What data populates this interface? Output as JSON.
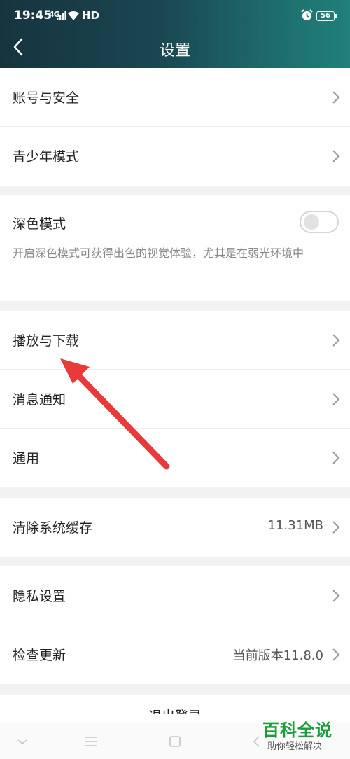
{
  "status_bar": {
    "time": "19:45",
    "network": "4G",
    "hd": "HD",
    "battery": "56"
  },
  "header": {
    "title": "设置"
  },
  "groups": {
    "account": [
      {
        "label": "账号与安全"
      },
      {
        "label": "青少年模式"
      }
    ],
    "dark_mode": {
      "title": "深色模式",
      "description": "开启深色模式可获得出色的视觉体验，尤其是在弱光环境中",
      "enabled": false
    },
    "media": [
      {
        "label": "播放与下载"
      },
      {
        "label": "消息通知"
      },
      {
        "label": "通用"
      }
    ],
    "cache": {
      "label": "清除系统缓存",
      "value": "11.31MB"
    },
    "privacy": [
      {
        "label": "隐私设置"
      },
      {
        "label": "检查更新",
        "value": "当前版本11.8.0"
      }
    ],
    "logout": {
      "label": "退出登录"
    }
  },
  "colors": {
    "annotation_arrow": "#e83a3a",
    "header_gradient_start": "#16343e",
    "header_gradient_end": "#218078",
    "watermark_green": "#1a9e3c"
  },
  "watermark": {
    "title": "百科全说",
    "subtitle": "助你轻松解决"
  }
}
